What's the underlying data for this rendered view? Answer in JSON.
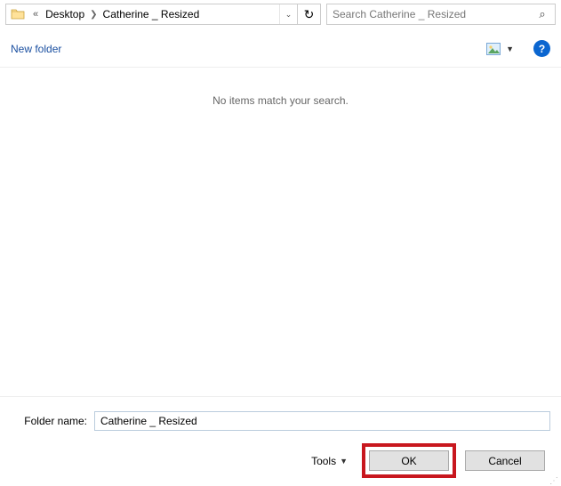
{
  "breadcrumb": {
    "root": "Desktop",
    "current": "Catherine _ Resized"
  },
  "search": {
    "placeholder": "Search Catherine _ Resized"
  },
  "cmdbar": {
    "new_folder": "New folder"
  },
  "content": {
    "empty_message": "No items match your search."
  },
  "footer": {
    "folder_name_label": "Folder name:",
    "folder_name_value": "Catherine _ Resized",
    "tools_label": "Tools",
    "ok_label": "OK",
    "cancel_label": "Cancel"
  }
}
